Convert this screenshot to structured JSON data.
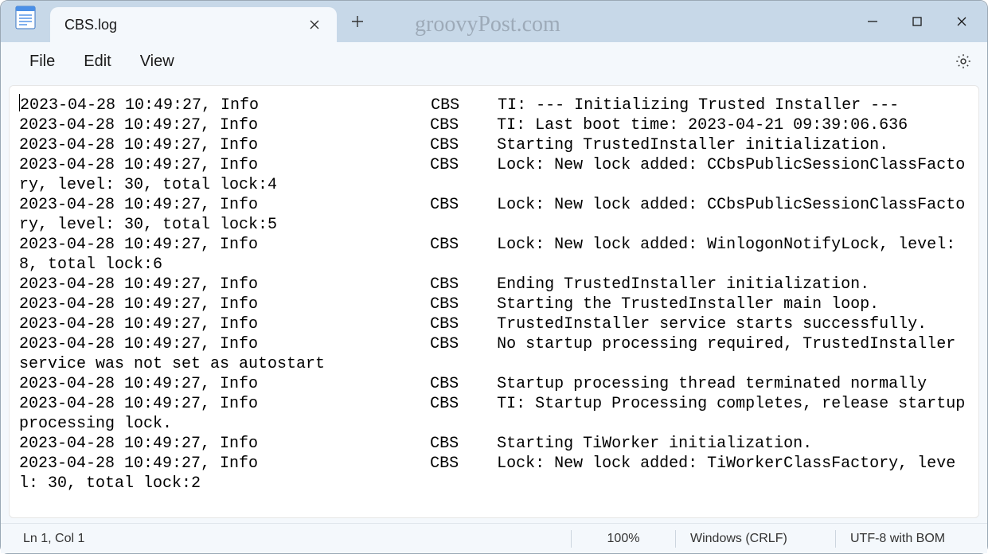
{
  "watermark": "groovyPost.com",
  "tab": {
    "title": "CBS.log",
    "close_glyph": "✕"
  },
  "new_tab_glyph": "＋",
  "menu": {
    "file": "File",
    "edit": "Edit",
    "view": "View"
  },
  "editor_text": "2023-04-28 10:49:27, Info                  CBS    TI: --- Initializing Trusted Installer ---\n2023-04-28 10:49:27, Info                  CBS    TI: Last boot time: 2023-04-21 09:39:06.636\n2023-04-28 10:49:27, Info                  CBS    Starting TrustedInstaller initialization.\n2023-04-28 10:49:27, Info                  CBS    Lock: New lock added: CCbsPublicSessionClassFactory, level: 30, total lock:4\n2023-04-28 10:49:27, Info                  CBS    Lock: New lock added: CCbsPublicSessionClassFactory, level: 30, total lock:5\n2023-04-28 10:49:27, Info                  CBS    Lock: New lock added: WinlogonNotifyLock, level: 8, total lock:6\n2023-04-28 10:49:27, Info                  CBS    Ending TrustedInstaller initialization.\n2023-04-28 10:49:27, Info                  CBS    Starting the TrustedInstaller main loop.\n2023-04-28 10:49:27, Info                  CBS    TrustedInstaller service starts successfully.\n2023-04-28 10:49:27, Info                  CBS    No startup processing required, TrustedInstaller service was not set as autostart\n2023-04-28 10:49:27, Info                  CBS    Startup processing thread terminated normally\n2023-04-28 10:49:27, Info                  CBS    TI: Startup Processing completes, release startup processing lock.\n2023-04-28 10:49:27, Info                  CBS    Starting TiWorker initialization.\n2023-04-28 10:49:27, Info                  CBS    Lock: New lock added: TiWorkerClassFactory, level: 30, total lock:2\n",
  "status": {
    "position": "Ln 1, Col 1",
    "zoom": "100%",
    "line_ending": "Windows (CRLF)",
    "encoding": "UTF-8 with BOM"
  }
}
